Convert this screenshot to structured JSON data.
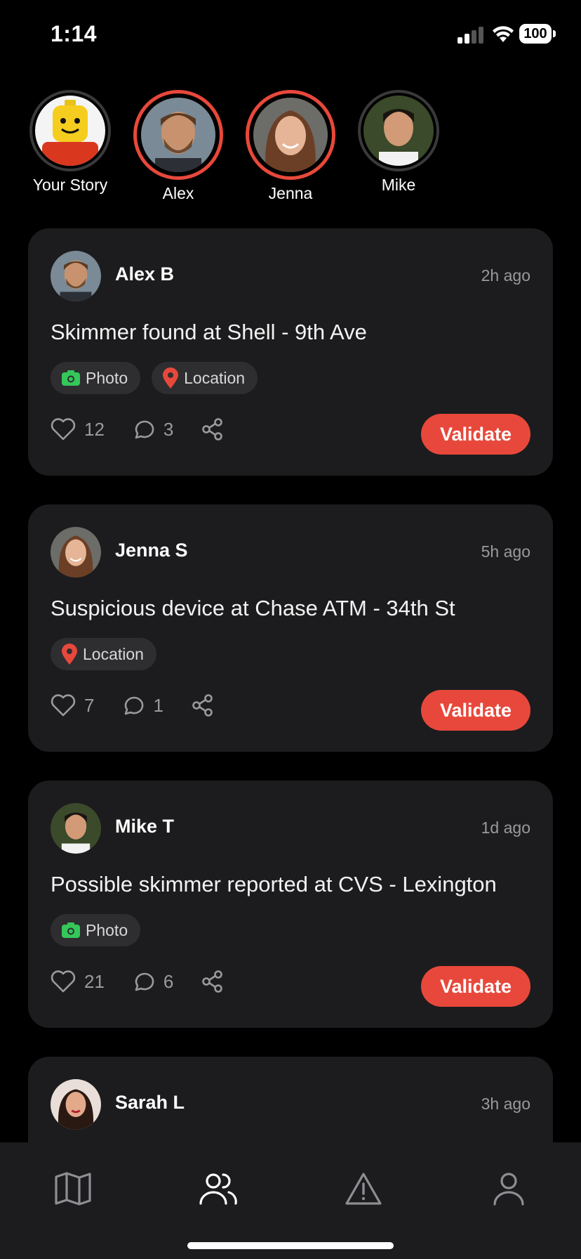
{
  "status_bar": {
    "time": "1:14",
    "battery": "100"
  },
  "stories": [
    {
      "label": "Your Story",
      "avatar": "lego-avatar",
      "state": "seen"
    },
    {
      "label": "Alex",
      "avatar": "alex-avatar",
      "state": "new"
    },
    {
      "label": "Jenna",
      "avatar": "jenna-avatar",
      "state": "new"
    },
    {
      "label": "Mike",
      "avatar": "mike-avatar",
      "state": "seen"
    }
  ],
  "posts": [
    {
      "name": "Alex B",
      "time": "2h ago",
      "title": "Skimmer found at Shell - 9th Ave",
      "tags": [
        "Photo",
        "Location"
      ],
      "likes": "12",
      "comments": "3",
      "action_label": "Validate"
    },
    {
      "name": "Jenna S",
      "time": "5h ago",
      "title": "Suspicious device at Chase ATM - 34th St",
      "tags": [
        "Location"
      ],
      "likes": "7",
      "comments": "1",
      "action_label": "Validate"
    },
    {
      "name": "Mike T",
      "time": "1d ago",
      "title": "Possible skimmer reported at CVS - Lexington",
      "tags": [
        "Photo"
      ],
      "likes": "21",
      "comments": "6",
      "action_label": "Validate"
    },
    {
      "name": "Sarah L",
      "time": "3h ago"
    }
  ],
  "tab_bar": {
    "tabs": [
      {
        "icon": "map-icon",
        "active": false
      },
      {
        "icon": "users-icon",
        "active": true
      },
      {
        "icon": "alert-triangle-icon",
        "active": false
      },
      {
        "icon": "profile-icon",
        "active": false
      }
    ]
  },
  "colors": {
    "accent": "#e8483b",
    "photo_tag": "#34c759",
    "card_bg": "#1c1c1e",
    "muted": "#9a9a9e"
  }
}
